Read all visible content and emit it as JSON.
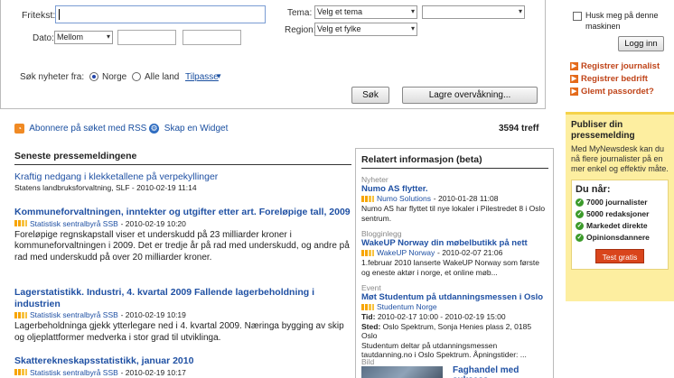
{
  "search": {
    "fritekst_label": "Fritekst:",
    "fritekst_value": "",
    "dato_label": "Dato:",
    "dato_value": "Mellom",
    "tema_label": "Tema:",
    "tema_value": "Velg et tema",
    "region_label": "Region:",
    "region_value": "Velg et fylke",
    "news_from_label": "Søk nyheter fra:",
    "radio_norge": "Norge",
    "radio_alle": "Alle land",
    "tilpasse": "Tilpasse",
    "search_button": "Søk",
    "save_button": "Lagre overvåkning..."
  },
  "login": {
    "remember": "Husk meg på denne maskinen",
    "login_button": "Logg inn",
    "links": [
      "Registrer journalist",
      "Registrer bedrift",
      "Glemt passordet?"
    ]
  },
  "toolbar": {
    "rss": "Abonnere på søket med RSS",
    "widget": "Skap en Widget",
    "count": "3594 treff"
  },
  "latest": {
    "heading": "Seneste pressemeldingene",
    "items": [
      {
        "title": "Kraftig nedgang i klekketallene på verpekyllinger",
        "meta": "Statens landbruksforvaltning, SLF - 2010-02-19 11:14",
        "source": "",
        "body": ""
      },
      {
        "title": "Kommuneforvaltningen, inntekter og utgifter etter art. Foreløpige tall, 2009",
        "meta": "- 2010-02-19 10:20",
        "source": "Statistisk sentralbyrå SSB",
        "body": "Foreløpige regnskapstall viser et underskudd på 23 milliarder kroner i kommuneforvaltningen i 2009. Det er tredje år på rad med underskudd, og andre på rad med underskudd på over 20 milliarder kroner."
      },
      {
        "title": "Lagerstatistikk. Industri, 4. kvartal 2009 Fallende lagerbeholdning i industrien",
        "meta": "- 2010-02-19 10:19",
        "source": "Statistisk sentralbyrå SSB",
        "body": "Lagerbeholdninga gjekk ytterlegare ned i 4. kvartal 2009. Næringa bygging av skip og oljeplattformer medverka i stor grad til utviklinga."
      },
      {
        "title": "Skatterekneskapsstatistikk, januar 2010",
        "meta": "- 2010-02-19 10:17",
        "source": "Statistisk sentralbyrå SSB",
        "body": ""
      }
    ]
  },
  "related": {
    "heading": "Relatert informasjon (beta)",
    "items": [
      {
        "cat": "Nyheter",
        "title": "Numo AS flytter.",
        "source": "Numo Solutions",
        "meta": "- 2010-01-28 11:08",
        "body": "Numo AS har flyttet til nye lokaler i Pilestredet 8 i Oslo sentrum."
      },
      {
        "cat": "Blogginlegg",
        "title": "WakeUP Norway din møbelbutikk på nett",
        "source": "WakeUP Norway",
        "meta": "- 2010-02-07 21:06",
        "body": "1.februar 2010 lanserte WakeUP Norway som første og eneste aktør i norge, et online møb..."
      },
      {
        "cat": "Event",
        "title": "Møt Studentum på utdanningsmessen i Oslo",
        "source": "Studentum Norge",
        "tid_label": "Tid:",
        "tid": "2010-02-17 10:00 - 2010-02-19 15:00",
        "sted_label": "Sted:",
        "sted": "Oslo Spektrum, Sonja Henies plass 2, 0185 Oslo",
        "body": "Studentum deltar på utdanningsmessen tautdanning.no i Oslo Spektrum. Åpningstider: ..."
      },
      {
        "cat": "Bild",
        "title": "Faghandel med suksess"
      }
    ]
  },
  "promo": {
    "heading": "Publiser din pressemelding",
    "text": "Med MyNewsdesk kan du nå flere journalister på en mer enkel og effektiv måte.",
    "du_nar": "Du når:",
    "checks": [
      "7000 journalister",
      "5000 redaksjoner",
      "Markedet direkte",
      "Opinionsdannere"
    ],
    "button": "Test gratis"
  },
  "colors": {
    "link": "#1f50a3",
    "accent": "#e46a1a",
    "promo_bg": "#fdeea0",
    "check": "#3b9a2a"
  }
}
